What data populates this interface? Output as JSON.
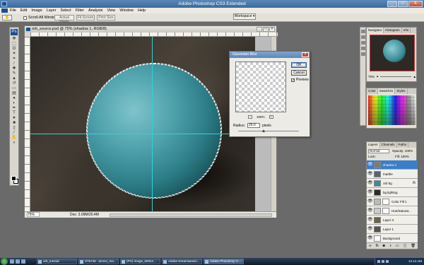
{
  "app": {
    "title": "Adobe Photoshop CS3 Extended",
    "window_buttons": [
      "_",
      "□",
      "X"
    ]
  },
  "menu": [
    "File",
    "Edit",
    "Image",
    "Layer",
    "Select",
    "Filter",
    "Analysis",
    "View",
    "Window",
    "Help"
  ],
  "options_bar": {
    "scroll_all": "Scroll All Windows",
    "actual_pixels": "Actual Pixels",
    "fit_screen": "Fit Screen",
    "print_size": "Print Size",
    "workspace": "Workspace ▾"
  },
  "document": {
    "title": "orb_source.psd @ 75% (shadow 1, RGB/8)",
    "zoom": "75%",
    "doc_info": "Doc: 3.09M/20.4M"
  },
  "gaussian_blur": {
    "title": "Gaussian Blur",
    "ok": "OK",
    "cancel": "Cancel",
    "preview_label": "Preview",
    "preview_checked": true,
    "zoom": "100%",
    "radius_label": "Radius:",
    "radius_value": "25.0",
    "radius_unit": "pixels"
  },
  "navigator": {
    "tabs": [
      "Navigator",
      "Histogram",
      "Info"
    ],
    "zoom": "75%"
  },
  "color_panel": {
    "tabs": [
      "Color",
      "Swatches",
      "Styles"
    ]
  },
  "layers_panel": {
    "tabs": [
      "Layers",
      "Channels",
      "Paths"
    ],
    "blend_mode": "Normal",
    "opacity": "Opacity: 100%",
    "lock": "Lock:",
    "fill": "Fill: 100%",
    "layers": [
      {
        "name": "shadow 1",
        "selected": true,
        "fx": false,
        "thumb": "#7a7a7a"
      },
      {
        "name": "marble",
        "selected": false,
        "fx": false,
        "thumb": "#59636a"
      },
      {
        "name": "orb bg",
        "selected": false,
        "fx": true,
        "thumb": "#3c8d96"
      },
      {
        "name": "bg lighting",
        "selected": false,
        "fx": false,
        "thumb": "#2e2a26"
      },
      {
        "name": "Color Fill 1",
        "selected": false,
        "fx": false,
        "thumb": "#bbbbbb"
      },
      {
        "name": "Hue/Saturat...",
        "selected": false,
        "fx": false,
        "thumb": "#cccccc"
      },
      {
        "name": "Layer 3",
        "selected": false,
        "fx": false,
        "thumb": "#6b6344"
      },
      {
        "name": "Layer 1",
        "selected": false,
        "fx": false,
        "thumb": "#5a5446"
      },
      {
        "name": "Background",
        "selected": false,
        "fx": false,
        "thumb": "#ffffff"
      }
    ],
    "footer_icons": [
      "link-icon",
      "fx-icon",
      "mask-icon",
      "adjust-icon",
      "folder-icon",
      "new-icon",
      "trash-icon"
    ]
  },
  "taskbar": {
    "tasks": [
      "orb_tutorial",
      "STEAM - ammo_ma...",
      "(PG) image_600x4...",
      "Adobe Dreamweave...",
      "Adobe Photoshop C..."
    ],
    "active_index": 4,
    "clock": "12:14 AM"
  }
}
